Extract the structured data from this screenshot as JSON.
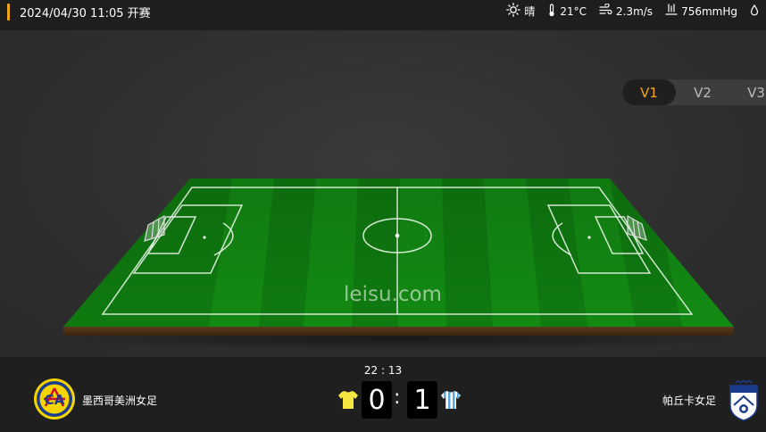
{
  "header": {
    "match_info": "2024/04/30 11:05 开赛",
    "weather": {
      "condition": "晴",
      "temperature": "21°C",
      "wind": "2.3m/s",
      "pressure": "756mmHg"
    }
  },
  "view_tabs": [
    {
      "label": "V1",
      "active": true
    },
    {
      "label": "V2",
      "active": false
    },
    {
      "label": "V3",
      "active": false
    }
  ],
  "pitch": {
    "watermark": "leisu.com"
  },
  "match": {
    "time": "22 : 13",
    "home_team": "墨西哥美洲女足",
    "away_team": "帕丘卡女足",
    "home_score": "0",
    "away_score": "1",
    "score_separator": ":"
  },
  "colors": {
    "accent": "#f2a51b",
    "home_kit": "#f5e642",
    "away_kit_stripe": "#5aa7e0"
  },
  "icons": {
    "weather": "sun-icon",
    "temperature": "thermometer-icon",
    "wind": "wind-icon",
    "pressure": "pressure-icon",
    "humidity": "droplet-icon"
  }
}
